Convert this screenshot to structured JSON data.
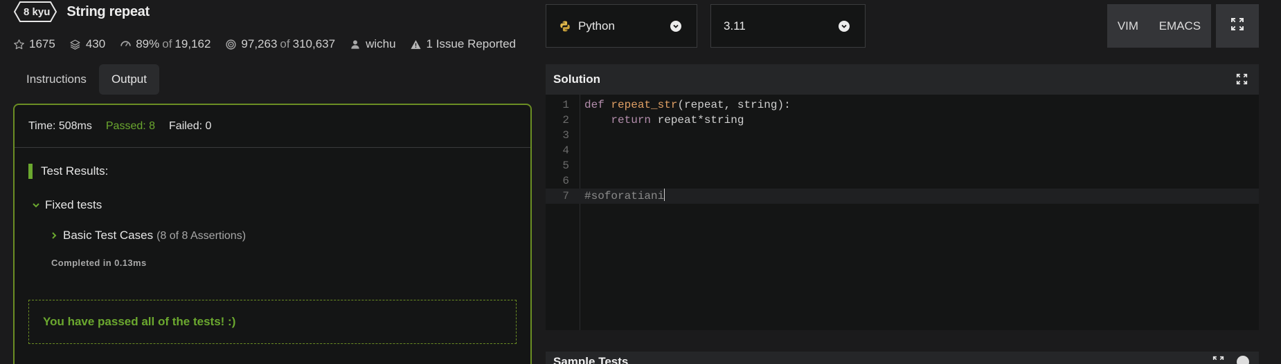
{
  "kata": {
    "rank": "8 kyu",
    "title": "String repeat"
  },
  "stats": {
    "stars": "1675",
    "collections": "430",
    "satisfaction": "89%",
    "satisfaction_of": "of",
    "votes": "19,162",
    "completed": "97,263",
    "completed_of": "of",
    "attempts": "310,637",
    "author": "wichu",
    "issues": "1 Issue Reported"
  },
  "tabs": [
    {
      "label": "Instructions",
      "active": false
    },
    {
      "label": "Output",
      "active": true
    }
  ],
  "output": {
    "time": "Time: 508ms",
    "passed": "Passed: 8",
    "failed": "Failed: 0",
    "results_title": "Test Results:",
    "group": "Fixed tests",
    "case": "Basic Test Cases",
    "assertions": "(8 of 8 Assertions)",
    "completed": "Completed in 0.13ms",
    "message": "You have passed all of the tests! :)"
  },
  "toolbar": {
    "language": "Python",
    "version": "3.11",
    "vim": "VIM",
    "emacs": "EMACS"
  },
  "solution": {
    "title": "Solution",
    "lines": [
      "1",
      "2",
      "3",
      "4",
      "5",
      "6",
      "7"
    ],
    "line7_comment": "#soforatiani"
  },
  "sample_tests": {
    "title": "Sample Tests"
  },
  "colors": {
    "accent_green": "#6ba82f",
    "border_green": "#6b8e23",
    "background": "#1b1b1c"
  }
}
